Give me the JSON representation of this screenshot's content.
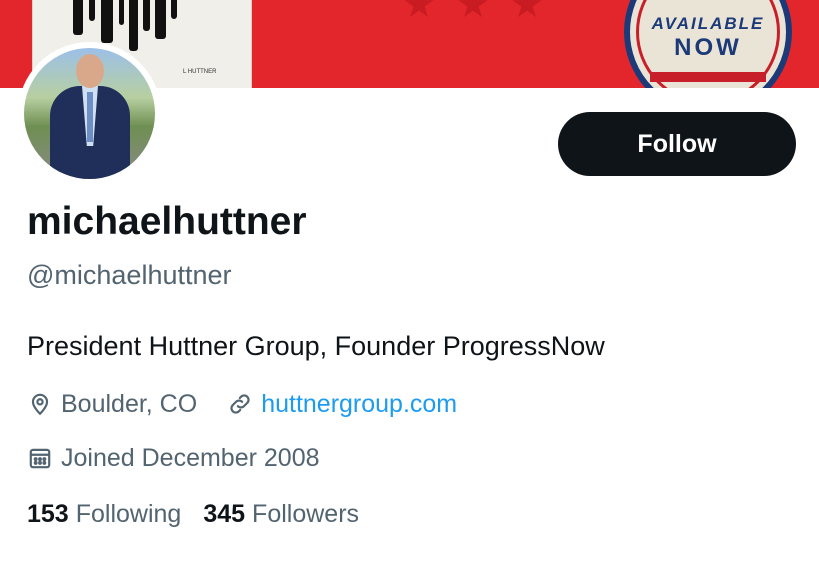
{
  "banner": {
    "badge_line1": "AVAILABLE",
    "badge_line2": "NOW",
    "book_text": "L HUTTNER"
  },
  "profile": {
    "display_name": "michaelhuttner",
    "handle": "@michaelhuttner",
    "bio": "President Huttner Group, Founder ProgressNow",
    "location": "Boulder, CO",
    "website": "huttnergroup.com",
    "joined": "Joined December 2008"
  },
  "actions": {
    "follow_label": "Follow"
  },
  "stats": {
    "following_count": "153",
    "following_label": "Following",
    "followers_count": "345",
    "followers_label": "Followers"
  },
  "icons": {
    "location": "location-pin-icon",
    "website": "link-icon",
    "joined": "calendar-icon"
  },
  "colors": {
    "banner_red": "#e3262c",
    "link_blue": "#1d9bf0",
    "secondary_text": "#536471",
    "button_bg": "#0f1419"
  }
}
